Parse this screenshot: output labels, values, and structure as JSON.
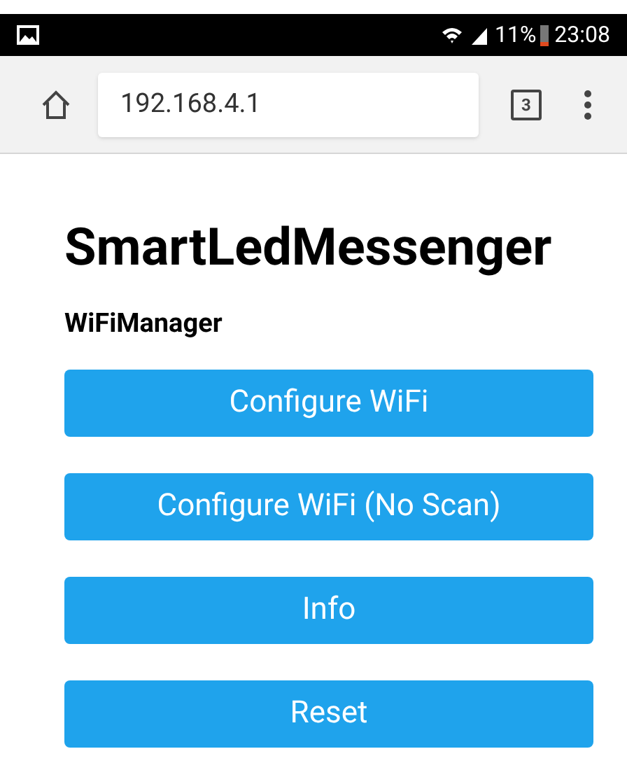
{
  "status_bar": {
    "battery": "11%",
    "time": "23:08"
  },
  "browser": {
    "url": "192.168.4.1",
    "tab_count": "3"
  },
  "page": {
    "title": "SmartLedMessenger",
    "subtitle": "WiFiManager",
    "buttons": [
      {
        "label": "Configure WiFi"
      },
      {
        "label": "Configure WiFi (No Scan)"
      },
      {
        "label": "Info"
      },
      {
        "label": "Reset"
      }
    ]
  }
}
